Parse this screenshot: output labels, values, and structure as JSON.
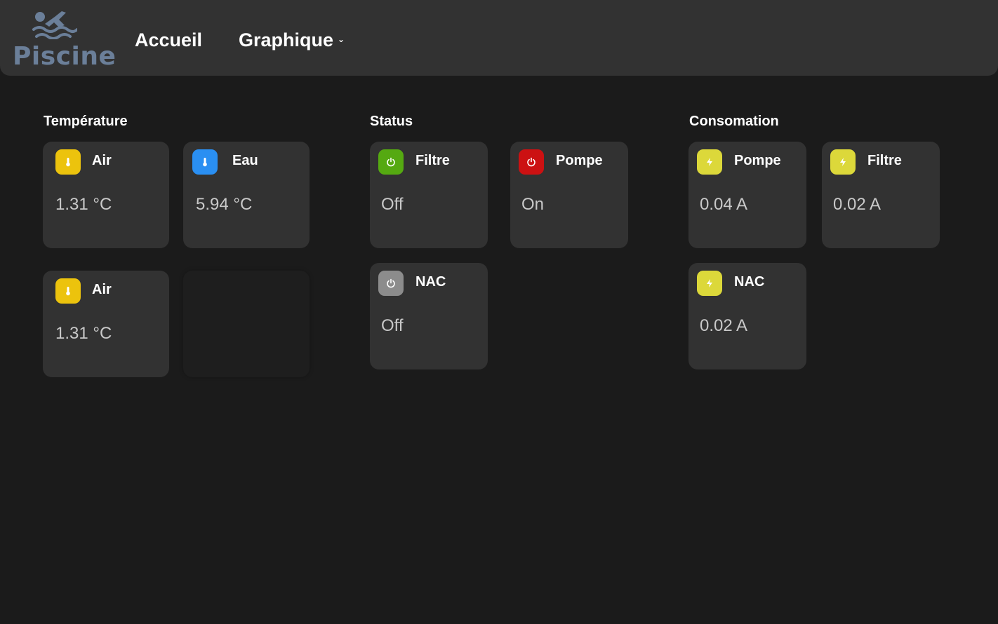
{
  "header": {
    "logo_text": "Piscine",
    "nav": {
      "home": "Accueil",
      "chart": "Graphique",
      "chart_caret": "⌄"
    }
  },
  "sections": {
    "temperature": {
      "title": "Température",
      "cards": [
        {
          "label": "Air",
          "value": "1.31 °C",
          "icon": "thermometer-icon",
          "color": "#ecc30d"
        },
        {
          "label": "Eau",
          "value": "5.94 °C",
          "icon": "thermometer-icon",
          "color": "#2a8ff2"
        },
        {
          "label": "Air",
          "value": "1.31 °C",
          "icon": "thermometer-icon",
          "color": "#ecc30d"
        }
      ]
    },
    "status": {
      "title": "Status",
      "cards": [
        {
          "label": "Filtre",
          "value": "Off",
          "icon": "power-icon",
          "color": "#55a911"
        },
        {
          "label": "Pompe",
          "value": "On",
          "icon": "power-icon",
          "color": "#cc1112"
        },
        {
          "label": "NAC",
          "value": "Off",
          "icon": "power-icon",
          "color": "#8c8c8c"
        }
      ]
    },
    "consumption": {
      "title": "Consomation",
      "cards": [
        {
          "label": "Pompe",
          "value": "0.04 A",
          "icon": "bolt-icon",
          "color": "#dcd83a"
        },
        {
          "label": "Filtre",
          "value": "0.02 A",
          "icon": "bolt-icon",
          "color": "#dcd83a"
        },
        {
          "label": "NAC",
          "value": "0.02 A",
          "icon": "bolt-icon",
          "color": "#dcd83a"
        }
      ]
    }
  }
}
